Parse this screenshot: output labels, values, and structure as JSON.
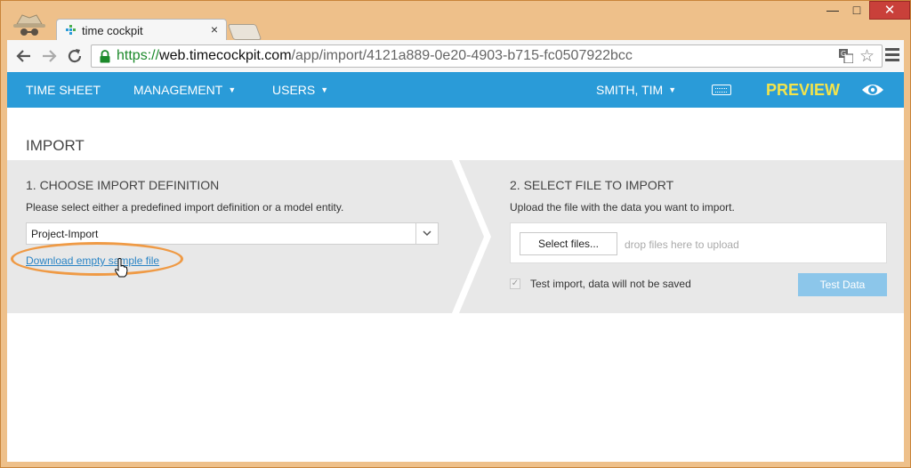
{
  "browser": {
    "tab_title": "time cockpit",
    "tab_close": "×",
    "url": {
      "scheme": "https://",
      "host": "web.timecockpit.com",
      "path": "/app/import/4121a889-0e20-4903-b715-fc0507922bcc"
    },
    "window_controls": {
      "minimize": "—",
      "maximize": "□",
      "close": "✕"
    },
    "star": "☆"
  },
  "nav": {
    "time_sheet": "TIME SHEET",
    "management": "MANAGEMENT",
    "users": "USERS",
    "user": "SMITH, TIM",
    "preview": "PREVIEW",
    "caret": "▼"
  },
  "page": {
    "title": "IMPORT"
  },
  "step1": {
    "title": "1. CHOOSE IMPORT DEFINITION",
    "description": "Please select either a predefined import definition or a model entity.",
    "selected_value": "Project-Import",
    "download_link": "Download empty sample file"
  },
  "step2": {
    "title": "2. SELECT FILE TO IMPORT",
    "description": "Upload the file with the data you want to import.",
    "select_files_label": "Select files...",
    "drop_hint": "drop files here to upload",
    "checkbox_mark": "✓",
    "checkbox_label": "Test import, data will not be saved",
    "test_button_label": "Test Data"
  },
  "colors": {
    "nav_bar": "#2a9bd8",
    "preview": "#f3e44b",
    "highlight": "#ef9a45",
    "link": "#2a84c5",
    "test_button": "#8cc6ea"
  }
}
